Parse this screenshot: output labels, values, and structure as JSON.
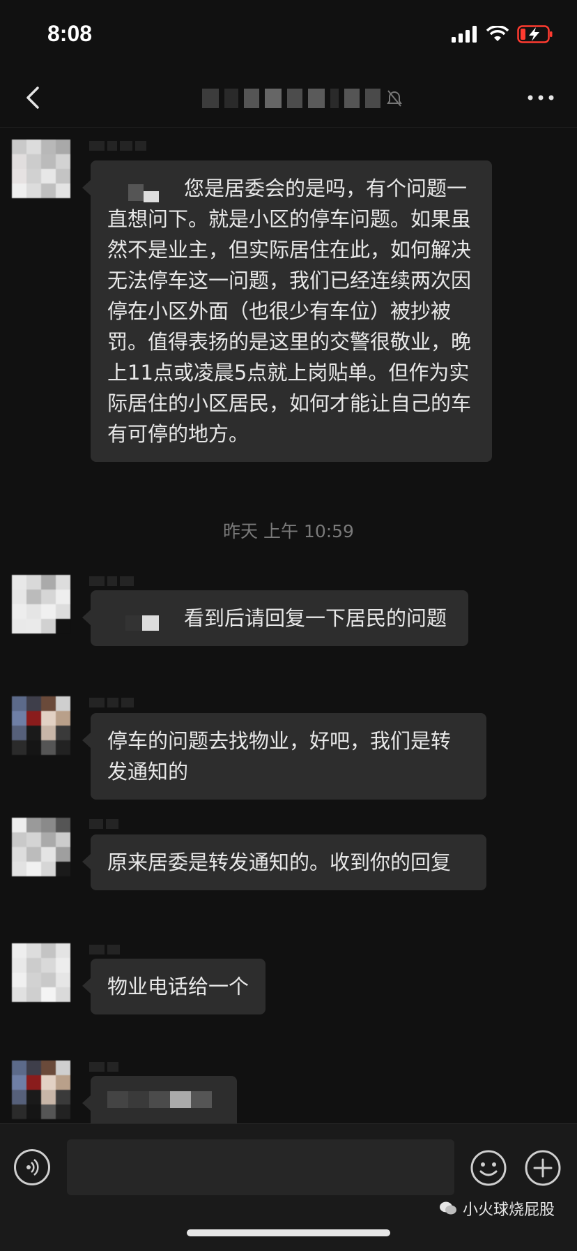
{
  "status": {
    "time": "8:08"
  },
  "header": {
    "back_icon": "chevron-left-icon",
    "more_icon": "more-icon",
    "mute_icon": "bell-muted-icon"
  },
  "messages": [
    {
      "text": "您是居委会的是吗，有个问题一直想问下。就是小区的停车问题。如果虽然不是业主，但实际居住在此，如何解决无法停车这一问题，我们已经连续两次因停在小区外面（也很少有车位）被抄被罚。值得表扬的是这里的交警很敬业，晚上11点或凌晨5点就上岗贴单。但作为实际居住的小区居民，如何才能让自己的车有可停的地方。"
    },
    {
      "text": "看到后请回复一下居民的问题"
    },
    {
      "text": "停车的问题去找物业，好吧，我们是转发通知的"
    },
    {
      "text": "原来居委是转发通知的。收到你的回复"
    },
    {
      "text": "物业电话给一个"
    }
  ],
  "timestamp": "昨天 上午 10:59",
  "watermark": "小火球烧屁股",
  "colors": {
    "background": "#111111",
    "bubble": "#2d2d2d",
    "battery_low": "#ff3b30"
  }
}
